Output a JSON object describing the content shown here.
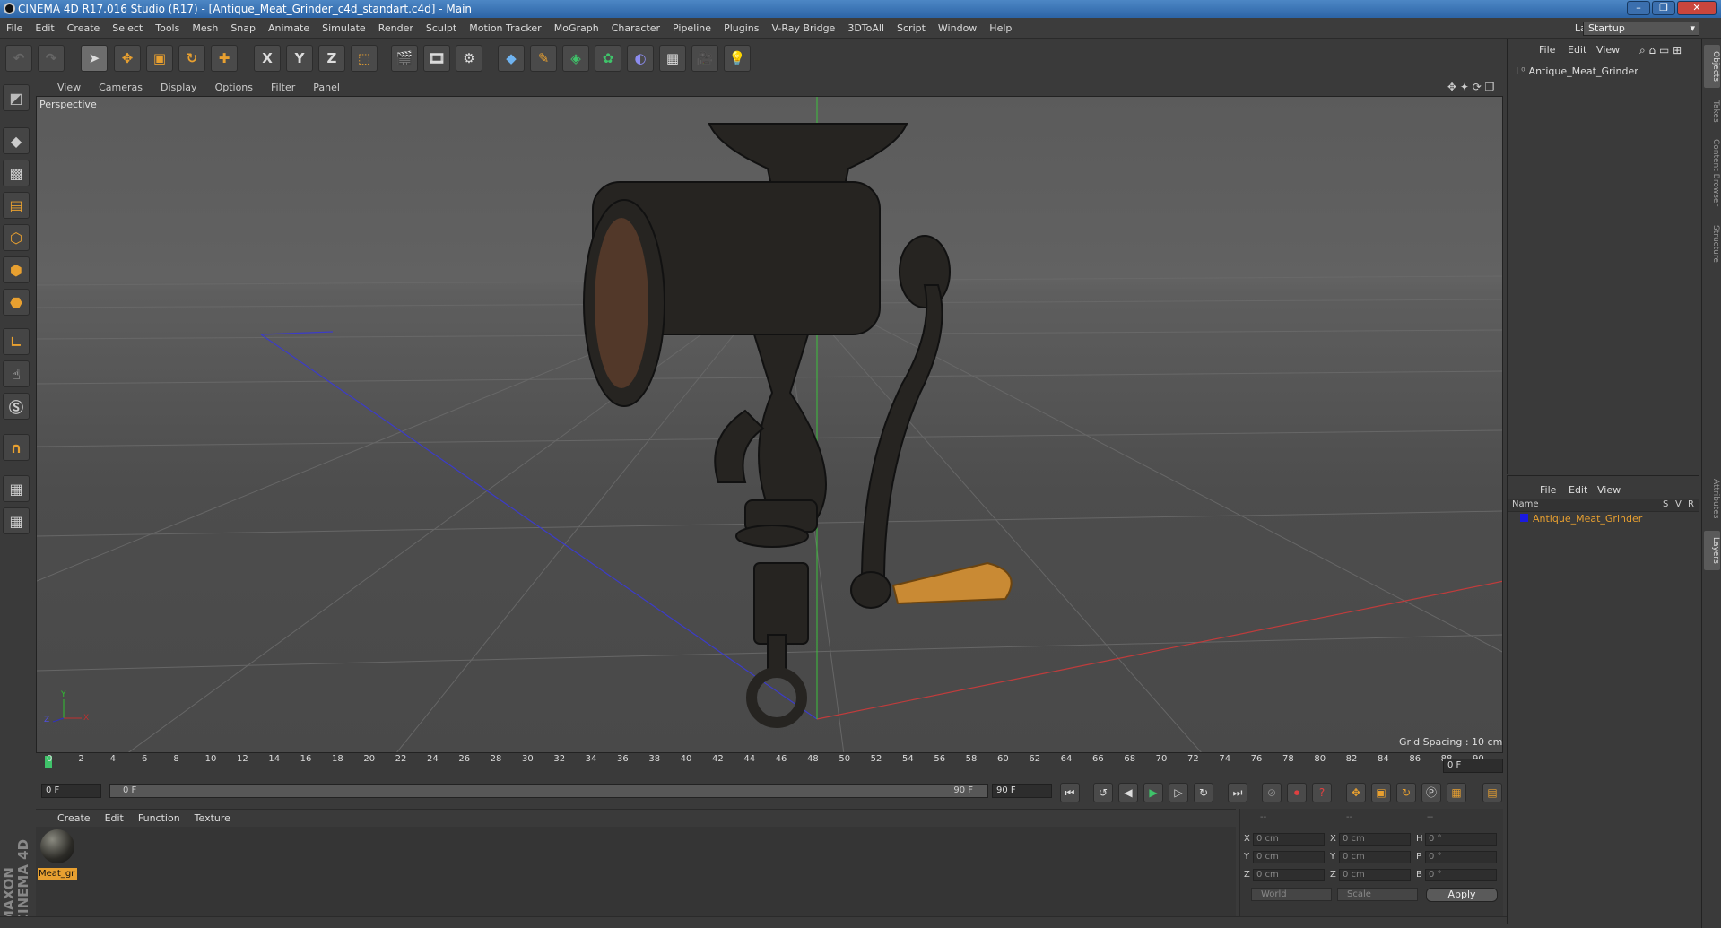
{
  "window": {
    "title": "CINEMA 4D R17.016 Studio (R17) - [Antique_Meat_Grinder_c4d_standart.c4d] - Main",
    "minimize": "–",
    "maximize": "❐",
    "close": "✕"
  },
  "menubar": {
    "items": [
      "File",
      "Edit",
      "Create",
      "Select",
      "Tools",
      "Mesh",
      "Snap",
      "Animate",
      "Simulate",
      "Render",
      "Sculpt",
      "Motion Tracker",
      "MoGraph",
      "Character",
      "Pipeline",
      "Plugins",
      "V-Ray Bridge",
      "3DToAll",
      "Script",
      "Window",
      "Help"
    ],
    "layout_label": "Layout:",
    "layout_value": "Startup"
  },
  "toolbar": {
    "x_label": "X",
    "y_label": "Y",
    "z_label": "Z"
  },
  "viewport": {
    "menu": [
      "View",
      "Cameras",
      "Display",
      "Options",
      "Filter",
      "Panel"
    ],
    "camera_label": "Perspective",
    "grid_spacing": "Grid Spacing : 10 cm",
    "axis_x": "X",
    "axis_y": "Y",
    "axis_z": "Z"
  },
  "timeline": {
    "ticks": [
      "0",
      "2",
      "4",
      "6",
      "8",
      "10",
      "12",
      "14",
      "16",
      "18",
      "20",
      "22",
      "24",
      "26",
      "28",
      "30",
      "32",
      "34",
      "36",
      "38",
      "40",
      "42",
      "44",
      "46",
      "48",
      "50",
      "52",
      "54",
      "56",
      "58",
      "60",
      "62",
      "64",
      "66",
      "68",
      "70",
      "72",
      "74",
      "76",
      "78",
      "80",
      "82",
      "84",
      "86",
      "88",
      "90"
    ],
    "current_frame": "0 F",
    "start_frame": "0 F",
    "range_start": "0 F",
    "range_end": "90 F",
    "end_frame": "90 F"
  },
  "material_manager": {
    "menu": [
      "Create",
      "Edit",
      "Function",
      "Texture"
    ],
    "material_name": "Meat_gr"
  },
  "coordinates": {
    "headers": [
      "--",
      "--",
      "--"
    ],
    "rows": [
      {
        "l1": "X",
        "v1": "0 cm",
        "l2": "X",
        "v2": "0 cm",
        "l3": "H",
        "v3": "0 °"
      },
      {
        "l1": "Y",
        "v1": "0 cm",
        "l2": "Y",
        "v2": "0 cm",
        "l3": "P",
        "v3": "0 °"
      },
      {
        "l1": "Z",
        "v1": "0 cm",
        "l2": "Z",
        "v2": "0 cm",
        "l3": "B",
        "v3": "0 °"
      }
    ],
    "space": "World",
    "mode": "Scale",
    "apply": "Apply"
  },
  "object_manager": {
    "menu": [
      "File",
      "Edit",
      "View"
    ],
    "object": "Antique_Meat_Grinder"
  },
  "layer_manager": {
    "menu": [
      "File",
      "Edit",
      "View"
    ],
    "col_name": "Name",
    "col_s": "S",
    "col_v": "V",
    "col_r": "R",
    "layer": "Antique_Meat_Grinder",
    "layer_color": "#1a1ae0"
  },
  "right_tabs": [
    "Objects",
    "Takes",
    "Content Browser",
    "Structure",
    "Attributes",
    "Layers"
  ],
  "branding": "MAXON CINEMA 4D",
  "colors": {
    "accent": "#e8a030",
    "x_axis": "#c03030",
    "y_axis": "#30c030",
    "z_axis": "#3030c0"
  }
}
